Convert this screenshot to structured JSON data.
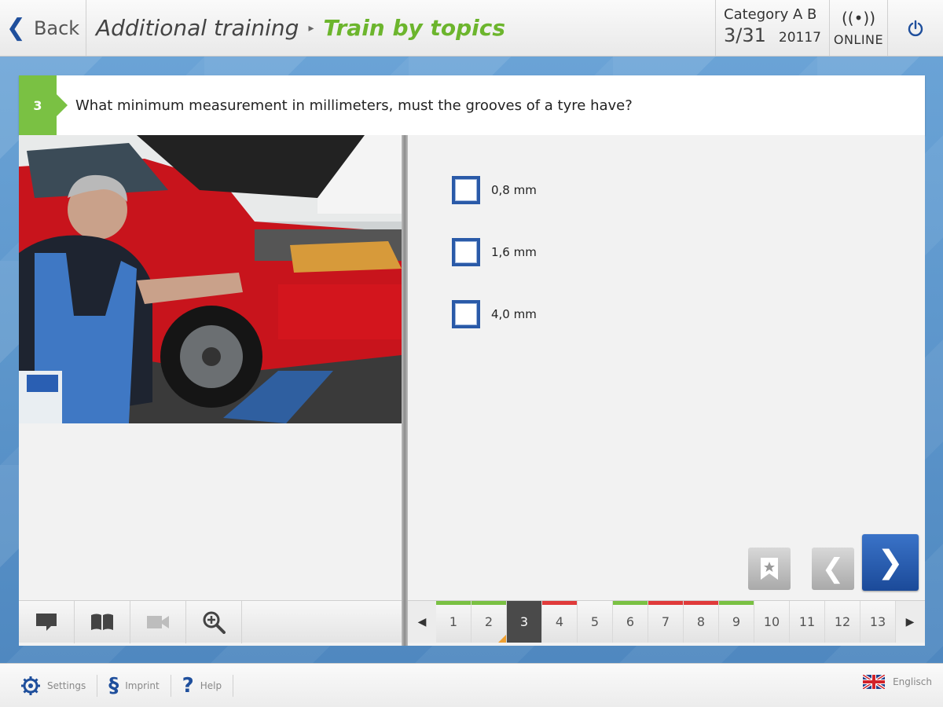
{
  "header": {
    "back_label": "Back",
    "breadcrumb_parent": "Additional training",
    "breadcrumb_current": "Train by topics",
    "category_label": "Category A B",
    "progress": "3/31",
    "question_code": "20117",
    "status": "ONLINE"
  },
  "question": {
    "number": "3",
    "text": "What minimum measurement in millimeters, must the grooves of a tyre have?"
  },
  "answers": [
    {
      "label": "0,8 mm",
      "checked": false
    },
    {
      "label": "1,6 mm",
      "checked": false
    },
    {
      "label": "4,0 mm",
      "checked": false
    }
  ],
  "media_tools": [
    "comment-icon",
    "book-icon",
    "video-icon",
    "zoom-icon"
  ],
  "pager": {
    "pages": [
      "1",
      "2",
      "3",
      "4",
      "5",
      "6",
      "7",
      "8",
      "9",
      "10",
      "11",
      "12",
      "13"
    ],
    "current": "3",
    "status_colors": {
      "correct": "#7ac143",
      "wrong": "#e03a3a"
    }
  },
  "footer": {
    "settings_label": "Settings",
    "imprint_label": "Imprint",
    "help_label": "Help",
    "language_label": "Englisch"
  },
  "colors": {
    "accent_green": "#7ac143",
    "brand_blue": "#1f4f9c",
    "next_button_blue": "#2a5fb3"
  }
}
